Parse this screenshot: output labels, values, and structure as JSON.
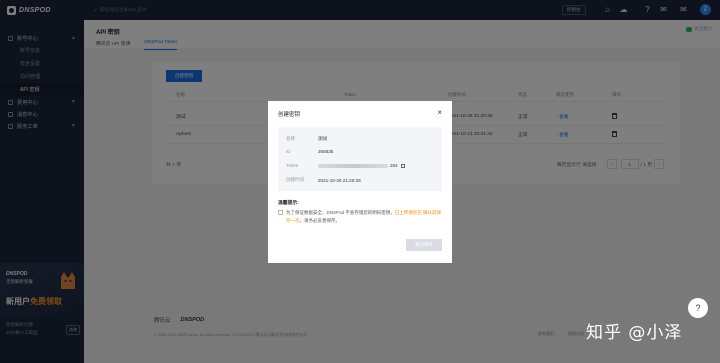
{
  "app": {
    "logo_text": "DNSPOD"
  },
  "sidebar": {
    "groups": [
      {
        "label": "账号中心",
        "items": [
          "账号信息",
          "安全设置",
          "访问管理",
          "API 密钥"
        ],
        "active_item": 3
      },
      {
        "label": "费用中心"
      },
      {
        "label": "消息中心"
      },
      {
        "label": "服务工单"
      }
    ],
    "promo": {
      "logo": "DNSPOD",
      "subtitle": "无限解析套餐",
      "headline_prefix": "新用户",
      "headline_highlight": "免费领取"
    },
    "bottom": {
      "line1": "您有解析问题",
      "line2": "10分钟人工响应",
      "button": "咨询"
    }
  },
  "topbar": {
    "search_placeholder": "域名/域名注册/SSL证书",
    "doc_button": "控制台",
    "icons": [
      "home-icon",
      "cloud-icon",
      "help-icon",
      "chat-icon",
      "mail-icon"
    ],
    "avatar_text": "Z"
  },
  "header": {
    "title": "API 密钥",
    "tabs": [
      "腾讯云 API 密钥",
      "DNSPod Token"
    ],
    "active_tab": 1,
    "wechat": "关注我们"
  },
  "table": {
    "create_button": "创建密钥",
    "columns": [
      "名称",
      "Token",
      "创建时间",
      "状态",
      "最近使用",
      "操作"
    ],
    "rows": [
      {
        "name": "测试",
        "time": "2021-10-26 21:20:28",
        "status": "正常",
        "last": "-",
        "link": "查看"
      },
      {
        "name": "Aphost",
        "time": "2021-10-13 20:41:42",
        "status": "正常",
        "last": "-",
        "link": "查看"
      }
    ],
    "total": "共 2 项",
    "per_page_label": "每页显示行 请选择",
    "page": "1",
    "pages": "/ 1 页"
  },
  "modal": {
    "title": "创建密钥",
    "close": "×",
    "fields": [
      {
        "key": "名称",
        "value": "测试"
      },
      {
        "key": "ID",
        "value": "266835"
      },
      {
        "key": "Token",
        "value": "264"
      },
      {
        "key": "创建时间",
        "value": "2021-10-26 21:20:28"
      }
    ],
    "warning_title": "温馨提示:",
    "warning_text": "为了保证数据安全，DNSPod 不会存储您的明码密钥，",
    "warning_highlight": "已上传请您在 确认前保存一次",
    "warning_tail": "，请务必妥善保存。",
    "confirm": "我已保存"
  },
  "footer": {
    "brand1": "腾讯云",
    "brand2": "DNSPOD",
    "copyright": "© 2006-2021 DNSPod Inc. All rights reserved. © 2006-2021 腾讯云计算(北京)有限责任公司",
    "links": [
      "联系我们",
      "帮助文档"
    ]
  },
  "watermark": "知乎 @小泽",
  "colors": {
    "accent": "#1a6fe8",
    "sidebar": "#1b2539",
    "promo_highlight": "#ff9a2e"
  }
}
